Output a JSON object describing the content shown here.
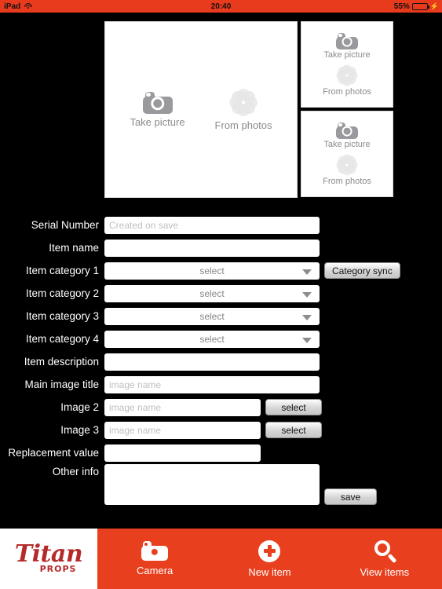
{
  "status_bar": {
    "device": "iPad",
    "wifi_icon": "wifi-icon",
    "time": "20:40",
    "battery_percent": "55%",
    "battery_level": 55,
    "charging_icon": "lightning-bolt-icon",
    "background_color": "#e83a1c"
  },
  "image_picker": {
    "main_pane": {
      "take_picture_label": "Take picture",
      "from_photos_label": "From photos",
      "camera_icon": "camera-icon",
      "photos_icon": "flower-photos-icon"
    },
    "side_panes": [
      {
        "take_picture_label": "Take picture",
        "from_photos_label": "From photos"
      },
      {
        "take_picture_label": "Take picture",
        "from_photos_label": "From photos"
      }
    ]
  },
  "form": {
    "serial_number": {
      "label": "Serial Number",
      "value": "",
      "placeholder": "Created on save"
    },
    "item_name": {
      "label": "Item name",
      "value": "",
      "placeholder": ""
    },
    "item_category_1": {
      "label": "Item category 1",
      "value": "select"
    },
    "item_category_2": {
      "label": "Item category 2",
      "value": "select"
    },
    "item_category_3": {
      "label": "Item category 3",
      "value": "select"
    },
    "item_category_4": {
      "label": "Item category 4",
      "value": "select"
    },
    "item_description": {
      "label": "Item description",
      "value": "",
      "placeholder": ""
    },
    "main_image_title": {
      "label": "Main image title",
      "value": "",
      "placeholder": "image name"
    },
    "image_2": {
      "label": "Image 2",
      "value": "",
      "placeholder": "image name",
      "button": "select"
    },
    "image_3": {
      "label": "Image 3",
      "value": "",
      "placeholder": "image name",
      "button": "select"
    },
    "replacement_value": {
      "label": "Replacement value",
      "value": "",
      "placeholder": ""
    },
    "other_info": {
      "label": "Other info",
      "value": "",
      "placeholder": ""
    },
    "category_sync_button": "Category sync",
    "save_button": "save"
  },
  "tab_bar": {
    "logo": {
      "name": "Titan",
      "subtitle": "PROPS",
      "color": "#b52a2a"
    },
    "background_color": "#e8401f",
    "tabs": [
      {
        "label": "Camera",
        "icon": "camera-icon"
      },
      {
        "label": "New item",
        "icon": "plus-circle-icon"
      },
      {
        "label": "View items",
        "icon": "magnifier-icon"
      }
    ]
  }
}
